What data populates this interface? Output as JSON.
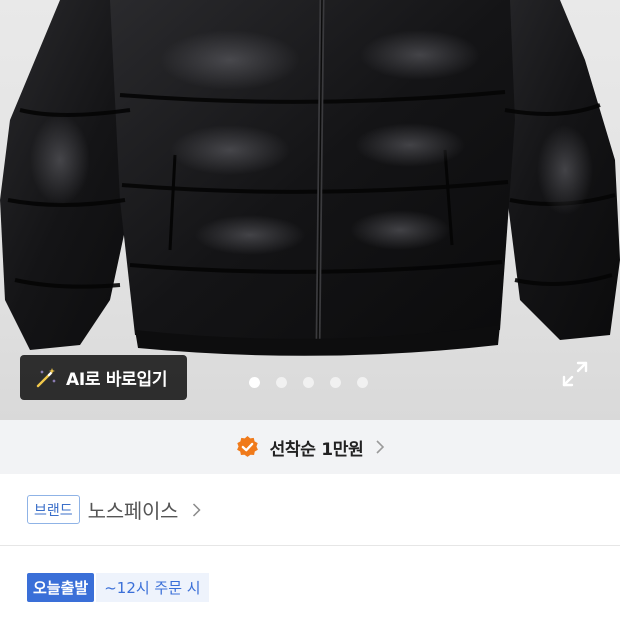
{
  "product_image": {
    "ai_try_on_label": "AI로 바로입기",
    "slide_count": 5,
    "active_slide": 1
  },
  "promo": {
    "text": "선착순 1만원"
  },
  "brand": {
    "tag": "브랜드",
    "name": "노스페이스"
  },
  "delivery": {
    "tag": "오늘출발",
    "cutoff": "~12시 주문 시"
  },
  "icons": {
    "ai": "magic-wand-icon",
    "expand": "expand-icon",
    "promo": "check-badge-icon",
    "chevron": "chevron-right-icon"
  },
  "colors": {
    "accent_blue": "#3a6fd8",
    "badge_orange": "#f07a1a",
    "banner_bg": "#f2f3f5"
  }
}
